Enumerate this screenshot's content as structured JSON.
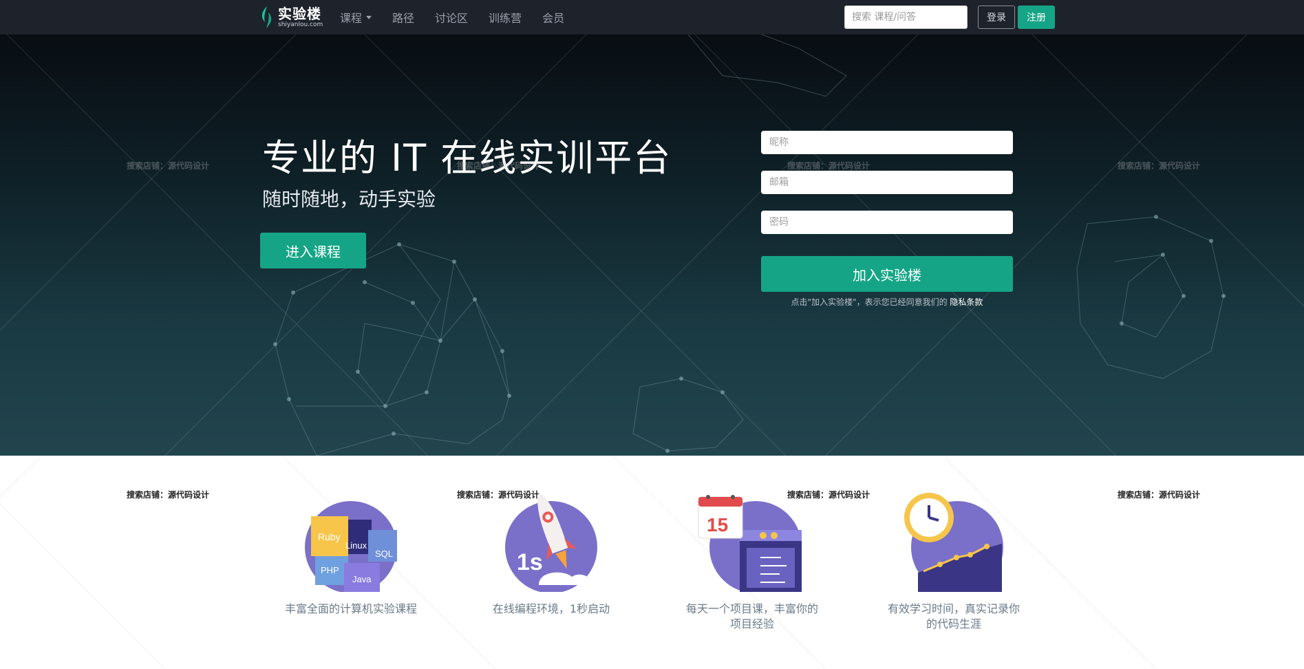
{
  "navbar": {
    "logo_name": "实验楼",
    "logo_sub": "shiyanlou.com",
    "links": [
      {
        "label": "课程",
        "has_dropdown": true
      },
      {
        "label": "路径",
        "has_dropdown": false
      },
      {
        "label": "讨论区",
        "has_dropdown": false
      },
      {
        "label": "训练营",
        "has_dropdown": false
      },
      {
        "label": "会员",
        "has_dropdown": false
      }
    ],
    "search_placeholder": "搜索 课程/问答",
    "login_label": "登录",
    "register_label": "注册"
  },
  "hero": {
    "title": "专业的 IT 在线实训平台",
    "subtitle": "随时随地，动手实验",
    "cta_label": "进入课程"
  },
  "signup_form": {
    "nickname_placeholder": "昵称",
    "email_placeholder": "邮箱",
    "password_placeholder": "密码",
    "submit_label": "加入实验楼",
    "terms_prefix": "点击\"加入实验楼\"，表示您已经同意我们的",
    "terms_link": "隐私条款"
  },
  "watermark_text": "搜索店铺：源代码设计",
  "features": [
    {
      "text": "丰富全面的计算机实验课程",
      "icon": "course-tiles-icon",
      "tiles": [
        "Ruby",
        "Linux",
        "SQL",
        "PHP",
        "Java"
      ]
    },
    {
      "text": "在线编程环境，1秒启动",
      "icon": "rocket-icon",
      "badge": "1s"
    },
    {
      "text": "每天一个项目课，丰富你的项目经验",
      "icon": "calendar-icon",
      "day": "15"
    },
    {
      "text": "有效学习时间，真实记录你的代码生涯",
      "icon": "clock-chart-icon"
    }
  ],
  "colors": {
    "navbar_bg": "#1e222b",
    "accent_green": "#15a586",
    "feature_purple": "#7a70c9",
    "feature_text": "#6a7a88"
  }
}
